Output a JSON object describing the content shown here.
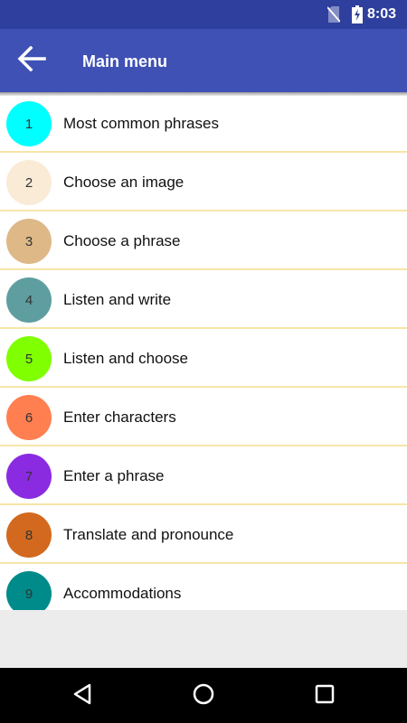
{
  "status_bar": {
    "time": "8:03",
    "icons": [
      "no-sim-icon",
      "battery-charging-icon"
    ]
  },
  "app_bar": {
    "title": "Main menu",
    "back_icon": "arrow-left-icon",
    "color": "#3f51b5"
  },
  "menu": {
    "items": [
      {
        "number": "1",
        "label": "Most common phrases",
        "color": "#00ffff"
      },
      {
        "number": "2",
        "label": "Choose an image",
        "color": "#faebd7"
      },
      {
        "number": "3",
        "label": "Choose a phrase",
        "color": "#deb887"
      },
      {
        "number": "4",
        "label": "Listen and write",
        "color": "#5f9ea0"
      },
      {
        "number": "5",
        "label": "Listen and choose",
        "color": "#7fff00"
      },
      {
        "number": "6",
        "label": "Enter characters",
        "color": "#ff7f50"
      },
      {
        "number": "7",
        "label": "Enter a phrase",
        "color": "#8a2be2"
      },
      {
        "number": "8",
        "label": "Translate and pronounce",
        "color": "#d2691e"
      },
      {
        "number": "9",
        "label": "Accommodations",
        "color": "#008b8b"
      }
    ],
    "divider_color": "#f7e5a6"
  },
  "nav_bar": {
    "buttons": [
      "back-triangle-icon",
      "home-circle-icon",
      "recents-square-icon"
    ]
  }
}
